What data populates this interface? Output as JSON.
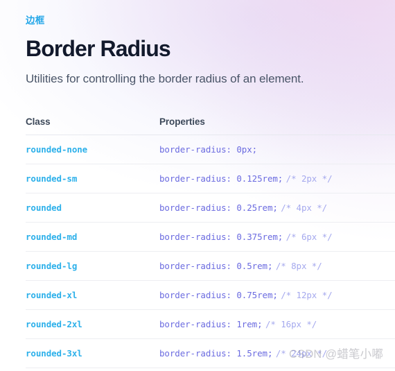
{
  "header": {
    "breadcrumb": "边框",
    "title": "Border Radius",
    "description": "Utilities for controlling the border radius of an element."
  },
  "table": {
    "columns": [
      "Class",
      "Properties"
    ],
    "rows": [
      {
        "class": "rounded-none",
        "code": "border-radius: 0px;",
        "comment": ""
      },
      {
        "class": "rounded-sm",
        "code": "border-radius: 0.125rem;",
        "comment": "/* 2px */"
      },
      {
        "class": "rounded",
        "code": "border-radius: 0.25rem;",
        "comment": "/* 4px */"
      },
      {
        "class": "rounded-md",
        "code": "border-radius: 0.375rem;",
        "comment": "/* 6px */"
      },
      {
        "class": "rounded-lg",
        "code": "border-radius: 0.5rem;",
        "comment": "/* 8px */"
      },
      {
        "class": "rounded-xl",
        "code": "border-radius: 0.75rem;",
        "comment": "/* 12px */"
      },
      {
        "class": "rounded-2xl",
        "code": "border-radius: 1rem;",
        "comment": "/* 16px */"
      },
      {
        "class": "rounded-3xl",
        "code": "border-radius: 1.5rem;",
        "comment": "/* 24px */"
      }
    ]
  },
  "watermark": {
    "text": "CSDN @蜡笔小嘟"
  },
  "colors": {
    "accent_link": "#22a6e8",
    "class_name": "#2cb0ea",
    "code": "#6b6be0",
    "comment": "#a5a9ee",
    "title": "#12192c",
    "description": "#4a5568",
    "divider": "#edeef2"
  }
}
